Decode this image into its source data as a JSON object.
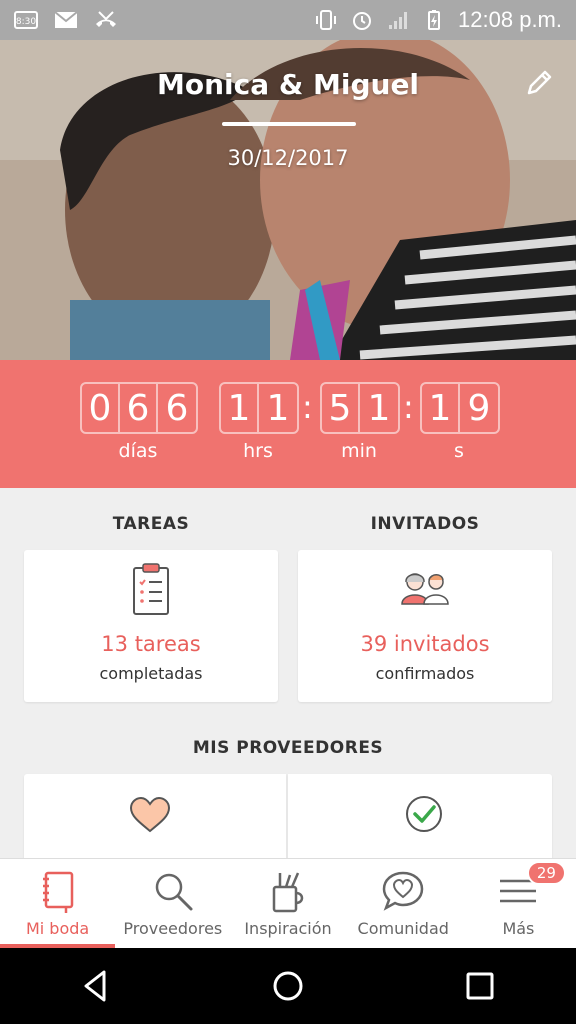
{
  "status_bar": {
    "time": "12:08 p.m.",
    "left_icons": [
      "weather-icon",
      "gmail-icon",
      "missed-call-icon"
    ],
    "right_icons": [
      "vibrate-icon",
      "alarm-icon",
      "signal-icon",
      "battery-icon"
    ]
  },
  "hero": {
    "couple_names": "Monica & Miguel",
    "wedding_date": "30/12/2017"
  },
  "countdown": {
    "days": [
      "0",
      "6",
      "6"
    ],
    "hours": [
      "1",
      "1"
    ],
    "minutes": [
      "5",
      "1"
    ],
    "seconds": [
      "1",
      "9"
    ],
    "labels": {
      "days": "días",
      "hours": "hrs",
      "minutes": "min",
      "seconds": "s"
    }
  },
  "tasks": {
    "title": "TAREAS",
    "count": "13 tareas",
    "sub": "completadas"
  },
  "guests": {
    "title": "INVITADOS",
    "count": "39 invitados",
    "sub": "confirmados"
  },
  "vendors": {
    "title": "MIS PROVEEDORES"
  },
  "bottom_nav": {
    "items": [
      {
        "label": "Mi boda",
        "icon": "notebook-icon",
        "active": true
      },
      {
        "label": "Proveedores",
        "icon": "search-icon"
      },
      {
        "label": "Inspiración",
        "icon": "tools-cup-icon"
      },
      {
        "label": "Comunidad",
        "icon": "chat-heart-icon"
      },
      {
        "label": "Más",
        "icon": "menu-icon",
        "badge": "29"
      }
    ]
  },
  "colors": {
    "accent": "#f0736f",
    "accent_text": "#e8605c"
  }
}
